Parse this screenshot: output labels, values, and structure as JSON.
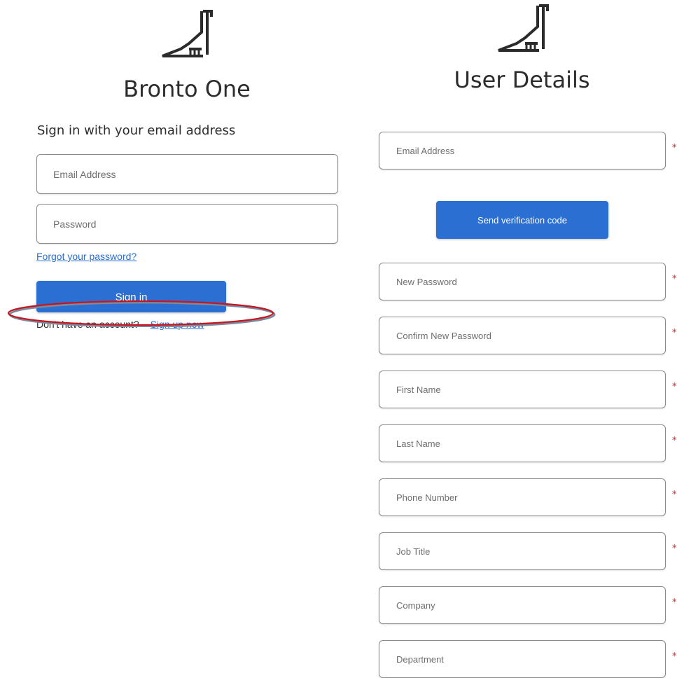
{
  "left": {
    "title": "Bronto One",
    "heading": "Sign in with your email address",
    "email_placeholder": "Email Address",
    "password_placeholder": "Password",
    "forgot_link": "Forgot your password?",
    "signin_button": "Sign in",
    "no_account_text": "Don't have an account?",
    "signup_link": "Sign up now"
  },
  "right": {
    "title": "User Details",
    "send_code_button": "Send verification code",
    "required_marker": "*",
    "fields": {
      "email": "Email Address",
      "new_password": "New Password",
      "confirm_password": "Confirm New Password",
      "first_name": "First Name",
      "last_name": "Last Name",
      "phone": "Phone Number",
      "job_title": "Job Title",
      "company": "Company",
      "department": "Department"
    }
  },
  "icons": {
    "logo": "dinosaur-logo-icon",
    "highlight": "red-ellipse-annotation"
  },
  "colors": {
    "primary": "#2a6fd1",
    "required": "#d62626",
    "annotation": "#c8141e",
    "text": "#2c2c2c"
  }
}
